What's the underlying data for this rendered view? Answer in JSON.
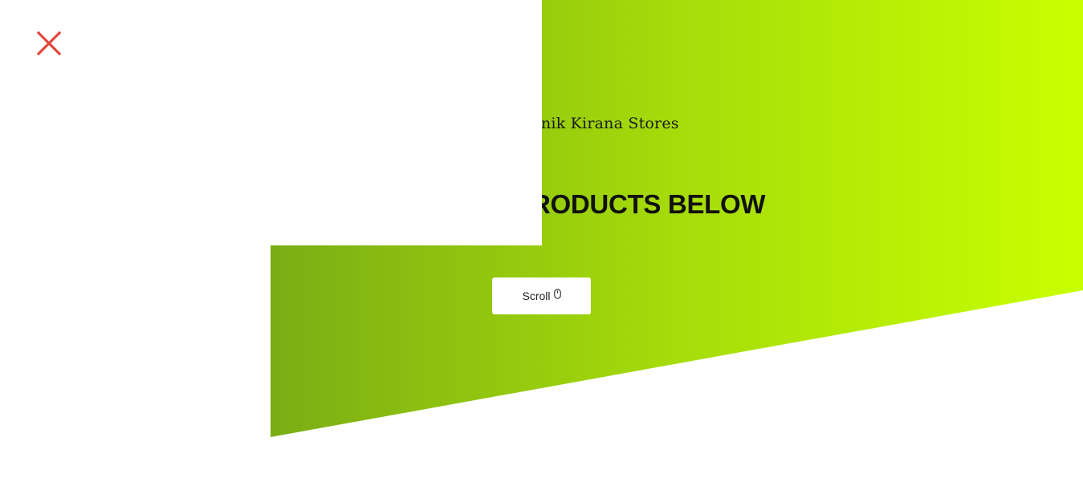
{
  "hero": {
    "subtitle": "nik Kirana Stores",
    "heading": "RODUCTS BELOW",
    "scroll_label": "Scroll",
    "scroll_icon": "mouse-icon"
  },
  "overlay": {
    "close_icon": "close-icon"
  },
  "colors": {
    "gradient_start": "#7aad14",
    "gradient_end": "#c8ff00",
    "close": "#e2463a"
  }
}
